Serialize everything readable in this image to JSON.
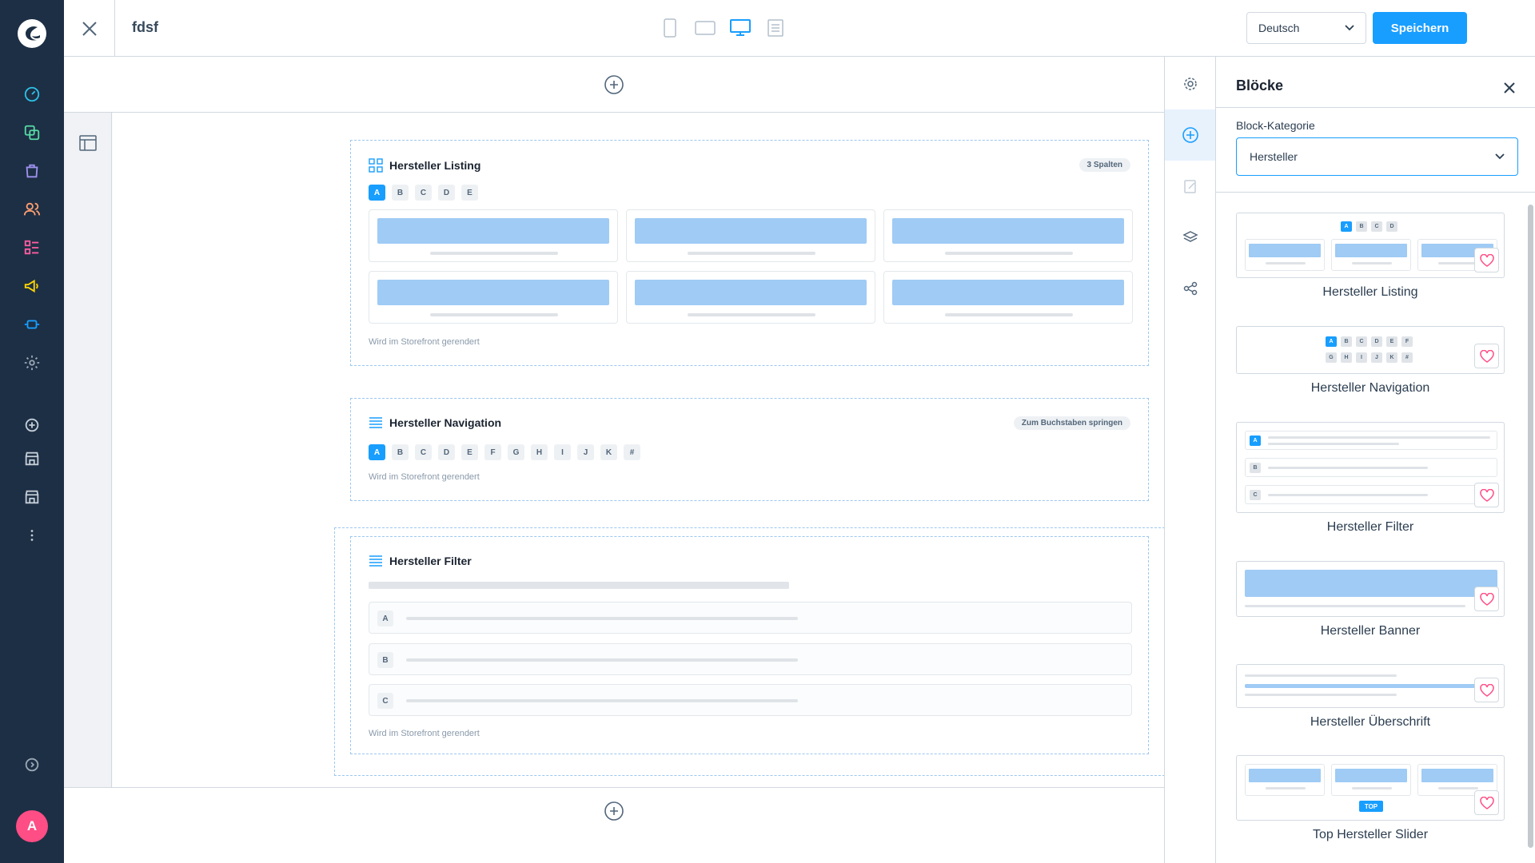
{
  "topbar": {
    "page_title": "fdsf",
    "language": "Deutsch",
    "save_label": "Speichern"
  },
  "canvas": {
    "listing": {
      "title": "Hersteller Listing",
      "badge": "3 Spalten",
      "letters": [
        "A",
        "B",
        "C",
        "D",
        "E"
      ],
      "footnote": "Wird im Storefront gerendert"
    },
    "navigation": {
      "title": "Hersteller Navigation",
      "badge": "Zum Buchstaben springen",
      "letters": [
        "A",
        "B",
        "C",
        "D",
        "E",
        "F",
        "G",
        "H",
        "I",
        "J",
        "K",
        "#"
      ],
      "footnote": "Wird im Storefront gerendert"
    },
    "filter": {
      "title": "Hersteller Filter",
      "rows": [
        "A",
        "B",
        "C"
      ],
      "footnote": "Wird im Storefront gerendert"
    }
  },
  "panel": {
    "title": "Blöcke",
    "category_label": "Block-Kategorie",
    "category_value": "Hersteller",
    "items": [
      {
        "label": "Hersteller Listing",
        "letters": [
          "A",
          "B",
          "C",
          "D"
        ]
      },
      {
        "label": "Hersteller Navigation",
        "letters_row1": [
          "A",
          "B",
          "C",
          "D",
          "E",
          "F"
        ],
        "letters_row2": [
          "G",
          "H",
          "I",
          "J",
          "K",
          "#"
        ]
      },
      {
        "label": "Hersteller Filter",
        "letters": [
          "A",
          "B",
          "C"
        ]
      },
      {
        "label": "Hersteller Banner"
      },
      {
        "label": "Hersteller Überschrift"
      },
      {
        "label": "Top Hersteller Slider",
        "tag": "TOP"
      }
    ]
  },
  "colors": {
    "nav_bg": "#1d2f45",
    "accent": "#189eff",
    "avatar": "#ff4d85",
    "placeholder": "#9fcbf5"
  },
  "icons": {
    "nav": [
      "dashboard-icon",
      "catalog-icon",
      "orders-icon",
      "customers-icon",
      "content-icon",
      "marketing-icon",
      "extensions-icon",
      "settings-icon",
      "add-icon",
      "storefront-icon",
      "storefront-icon",
      "more-icon",
      "expand-icon"
    ],
    "side": [
      "gear-icon",
      "add-block-icon",
      "edit-icon",
      "layers-icon",
      "share-icon"
    ]
  },
  "user": {
    "initial": "A"
  }
}
